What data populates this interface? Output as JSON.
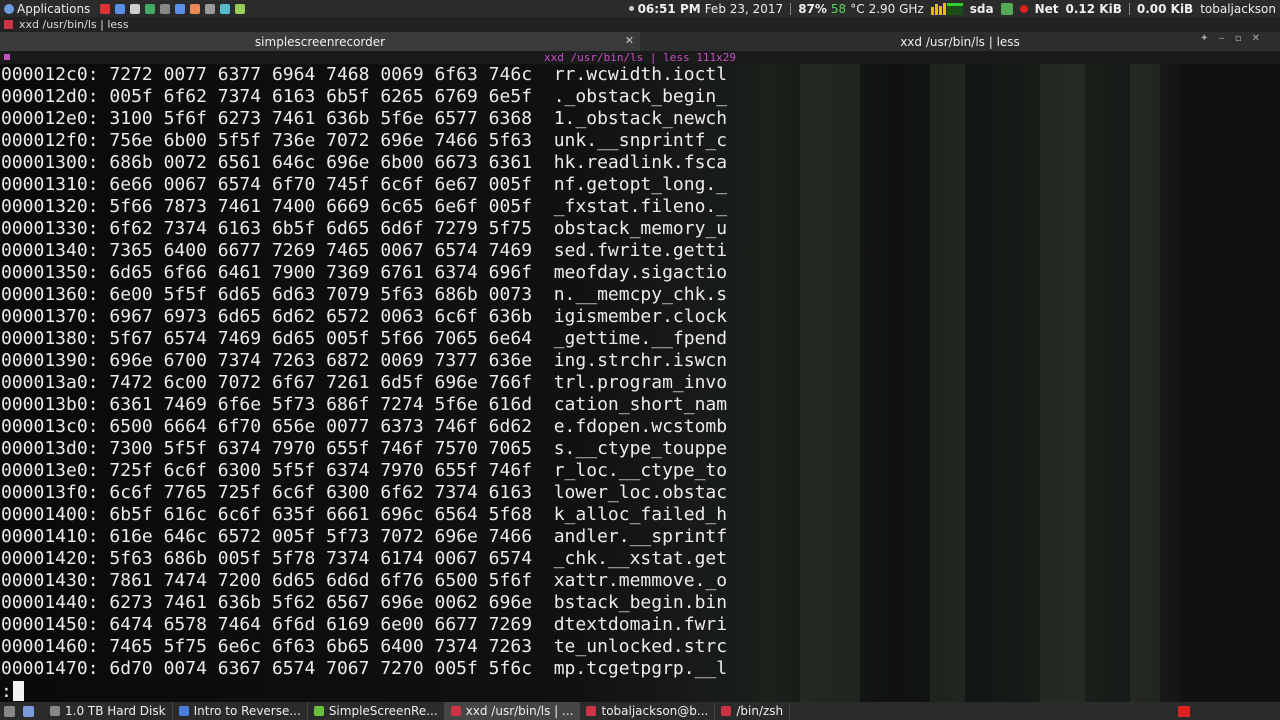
{
  "top_panel": {
    "apps_label": "Applications",
    "time": "06:51 PM",
    "date": "Feb 23, 2017",
    "battery": "87%",
    "temperature": "58",
    "temp_unit": "°C",
    "cpu_freq": "2.90 GHz",
    "disk_label": "sda",
    "net_label": "Net",
    "net_down": "0.12 KiB",
    "net_up": "0.00 KiB",
    "username": "tobaljackson"
  },
  "window_title": "xxd /usr/bin/ls | less",
  "tabs": [
    {
      "label": "simplescreenrecorder"
    },
    {
      "label": "xxd /usr/bin/ls | less"
    }
  ],
  "pane_title": "xxd /usr/bin/ls | less 111x29",
  "hex_lines": [
    {
      "addr": "000012c0:",
      "hex": "7272 0077 6377 6964 7468 0069 6f63 746c",
      "ascii": "rr.wcwidth.ioctl"
    },
    {
      "addr": "000012d0:",
      "hex": "005f 6f62 7374 6163 6b5f 6265 6769 6e5f",
      "ascii": "._obstack_begin_"
    },
    {
      "addr": "000012e0:",
      "hex": "3100 5f6f 6273 7461 636b 5f6e 6577 6368",
      "ascii": "1._obstack_newch"
    },
    {
      "addr": "000012f0:",
      "hex": "756e 6b00 5f5f 736e 7072 696e 7466 5f63",
      "ascii": "unk.__snprintf_c"
    },
    {
      "addr": "00001300:",
      "hex": "686b 0072 6561 646c 696e 6b00 6673 6361",
      "ascii": "hk.readlink.fsca"
    },
    {
      "addr": "00001310:",
      "hex": "6e66 0067 6574 6f70 745f 6c6f 6e67 005f",
      "ascii": "nf.getopt_long._"
    },
    {
      "addr": "00001320:",
      "hex": "5f66 7873 7461 7400 6669 6c65 6e6f 005f",
      "ascii": "_fxstat.fileno._"
    },
    {
      "addr": "00001330:",
      "hex": "6f62 7374 6163 6b5f 6d65 6d6f 7279 5f75",
      "ascii": "obstack_memory_u"
    },
    {
      "addr": "00001340:",
      "hex": "7365 6400 6677 7269 7465 0067 6574 7469",
      "ascii": "sed.fwrite.getti"
    },
    {
      "addr": "00001350:",
      "hex": "6d65 6f66 6461 7900 7369 6761 6374 696f",
      "ascii": "meofday.sigactio"
    },
    {
      "addr": "00001360:",
      "hex": "6e00 5f5f 6d65 6d63 7079 5f63 686b 0073",
      "ascii": "n.__memcpy_chk.s"
    },
    {
      "addr": "00001370:",
      "hex": "6967 6973 6d65 6d62 6572 0063 6c6f 636b",
      "ascii": "igismember.clock"
    },
    {
      "addr": "00001380:",
      "hex": "5f67 6574 7469 6d65 005f 5f66 7065 6e64",
      "ascii": "_gettime.__fpend"
    },
    {
      "addr": "00001390:",
      "hex": "696e 6700 7374 7263 6872 0069 7377 636e",
      "ascii": "ing.strchr.iswcn"
    },
    {
      "addr": "000013a0:",
      "hex": "7472 6c00 7072 6f67 7261 6d5f 696e 766f",
      "ascii": "trl.program_invo"
    },
    {
      "addr": "000013b0:",
      "hex": "6361 7469 6f6e 5f73 686f 7274 5f6e 616d",
      "ascii": "cation_short_nam"
    },
    {
      "addr": "000013c0:",
      "hex": "6500 6664 6f70 656e 0077 6373 746f 6d62",
      "ascii": "e.fdopen.wcstomb"
    },
    {
      "addr": "000013d0:",
      "hex": "7300 5f5f 6374 7970 655f 746f 7570 7065",
      "ascii": "s.__ctype_touppe"
    },
    {
      "addr": "000013e0:",
      "hex": "725f 6c6f 6300 5f5f 6374 7970 655f 746f",
      "ascii": "r_loc.__ctype_to"
    },
    {
      "addr": "000013f0:",
      "hex": "6c6f 7765 725f 6c6f 6300 6f62 7374 6163",
      "ascii": "lower_loc.obstac"
    },
    {
      "addr": "00001400:",
      "hex": "6b5f 616c 6c6f 635f 6661 696c 6564 5f68",
      "ascii": "k_alloc_failed_h"
    },
    {
      "addr": "00001410:",
      "hex": "616e 646c 6572 005f 5f73 7072 696e 7466",
      "ascii": "andler.__sprintf"
    },
    {
      "addr": "00001420:",
      "hex": "5f63 686b 005f 5f78 7374 6174 0067 6574",
      "ascii": "_chk.__xstat.get"
    },
    {
      "addr": "00001430:",
      "hex": "7861 7474 7200 6d65 6d6d 6f76 6500 5f6f",
      "ascii": "xattr.memmove._o"
    },
    {
      "addr": "00001440:",
      "hex": "6273 7461 636b 5f62 6567 696e 0062 696e",
      "ascii": "bstack_begin.bin"
    },
    {
      "addr": "00001450:",
      "hex": "6474 6578 7464 6f6d 6169 6e00 6677 7269",
      "ascii": "dtextdomain.fwri"
    },
    {
      "addr": "00001460:",
      "hex": "7465 5f75 6e6c 6f63 6b65 6400 7374 7263",
      "ascii": "te_unlocked.strc"
    },
    {
      "addr": "00001470:",
      "hex": "6d70 0074 6367 6574 7067 7270 005f 5f6c",
      "ascii": "mp.tcgetpgrp.__l"
    }
  ],
  "prompt": ":",
  "taskbar": {
    "tasks": [
      {
        "label": "1.0 TB Hard Disk",
        "icon": "disk-icon",
        "color": "#888888"
      },
      {
        "label": "Intro to Reverse...",
        "icon": "browser-icon",
        "color": "#4a7fe0"
      },
      {
        "label": "SimpleScreenRe...",
        "icon": "recorder-icon",
        "color": "#6bbf3b"
      },
      {
        "label": "xxd /usr/bin/ls | ...",
        "icon": "terminal-icon",
        "color": "#cc3344"
      },
      {
        "label": "tobaljackson@b...",
        "icon": "terminal-icon",
        "color": "#cc3344"
      },
      {
        "label": "/bin/zsh",
        "icon": "terminal-icon",
        "color": "#cc3344"
      }
    ]
  }
}
